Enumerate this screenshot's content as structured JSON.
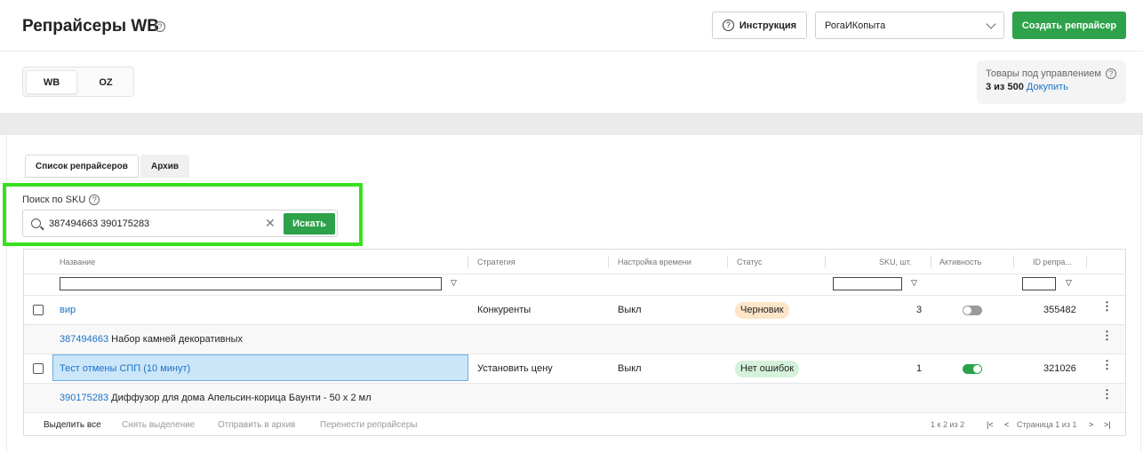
{
  "header": {
    "title": "Репрайсеры WB",
    "instruction_label": "Инструкция",
    "shop_selected": "РогаИКопыта",
    "create_label": "Создать репрайсер"
  },
  "marketplaces": [
    "WB",
    "OZ"
  ],
  "managed": {
    "title": "Товары под управлением",
    "count": "3 из 500",
    "buy_link": "Докупить"
  },
  "tabs": [
    "Список репрайсеров",
    "Архив"
  ],
  "search": {
    "label": "Поиск по SKU",
    "value": "387494663 390175283",
    "button": "Искать"
  },
  "table": {
    "columns": [
      "Название",
      "Стратегия",
      "Настройка времени",
      "Статус",
      "SKU, шт.",
      "Активность",
      "ID репра..."
    ],
    "rows": [
      {
        "name": "вир",
        "strategy": "Конкуренты",
        "time": "Выкл",
        "status": "Черновик",
        "sku": "3",
        "active": false,
        "id": "355482"
      },
      {
        "name": "Тест отмены СПП (10 минут)",
        "strategy": "Установить цену",
        "time": "Выкл",
        "status": "Нет ошибок",
        "sku": "1",
        "active": true,
        "id": "321026"
      }
    ],
    "sku_rows": [
      {
        "sku": "387494663",
        "title": "Набор камней декоративных"
      },
      {
        "sku": "390175283",
        "title": "Диффузор для дома Апельсин-корица Баунти - 50 x 2 мл"
      }
    ]
  },
  "footer": {
    "select_all": "Выделить все",
    "deselect": "Снять выделение",
    "archive": "Отправить в архив",
    "move": "Перенести репрайсеры",
    "range": "1 к 2 из 2",
    "page": "Страница 1 из 1"
  },
  "colors": {
    "accent_green": "#2da24a",
    "link_blue": "#1a73c9",
    "highlight_green": "#37e01d"
  }
}
